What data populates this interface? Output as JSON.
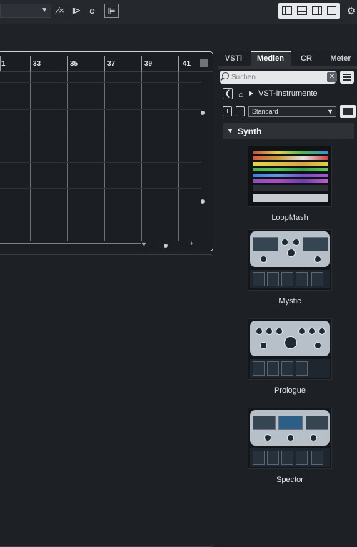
{
  "toolbar": {
    "buttons": [
      "snap-type",
      "quantize",
      "edit-mode",
      "constraint"
    ],
    "layout_buttons": [
      "left-zone",
      "lower-zone",
      "right-zone",
      "control-room"
    ]
  },
  "ruler": {
    "bars": [
      "1",
      "33",
      "35",
      "37",
      "39",
      "41"
    ]
  },
  "right_zone": {
    "tabs": [
      {
        "label": "VSTi",
        "active": false
      },
      {
        "label": "Medien",
        "active": true
      },
      {
        "label": "CR",
        "active": false
      },
      {
        "label": "Meter",
        "active": false
      }
    ],
    "search": {
      "placeholder": "Suchen",
      "value": ""
    },
    "breadcrumb": {
      "location": "VST-Instrumente"
    },
    "preset": {
      "selected": "Standard"
    },
    "category": {
      "label": "Synth"
    },
    "instruments": [
      {
        "name": "LoopMash"
      },
      {
        "name": "Mystic"
      },
      {
        "name": "Prologue"
      },
      {
        "name": "Spector"
      }
    ]
  },
  "colors": {
    "background": "#1d2025",
    "panel_border": "#cfd3d8",
    "accent_light": "#e6e7e9"
  }
}
